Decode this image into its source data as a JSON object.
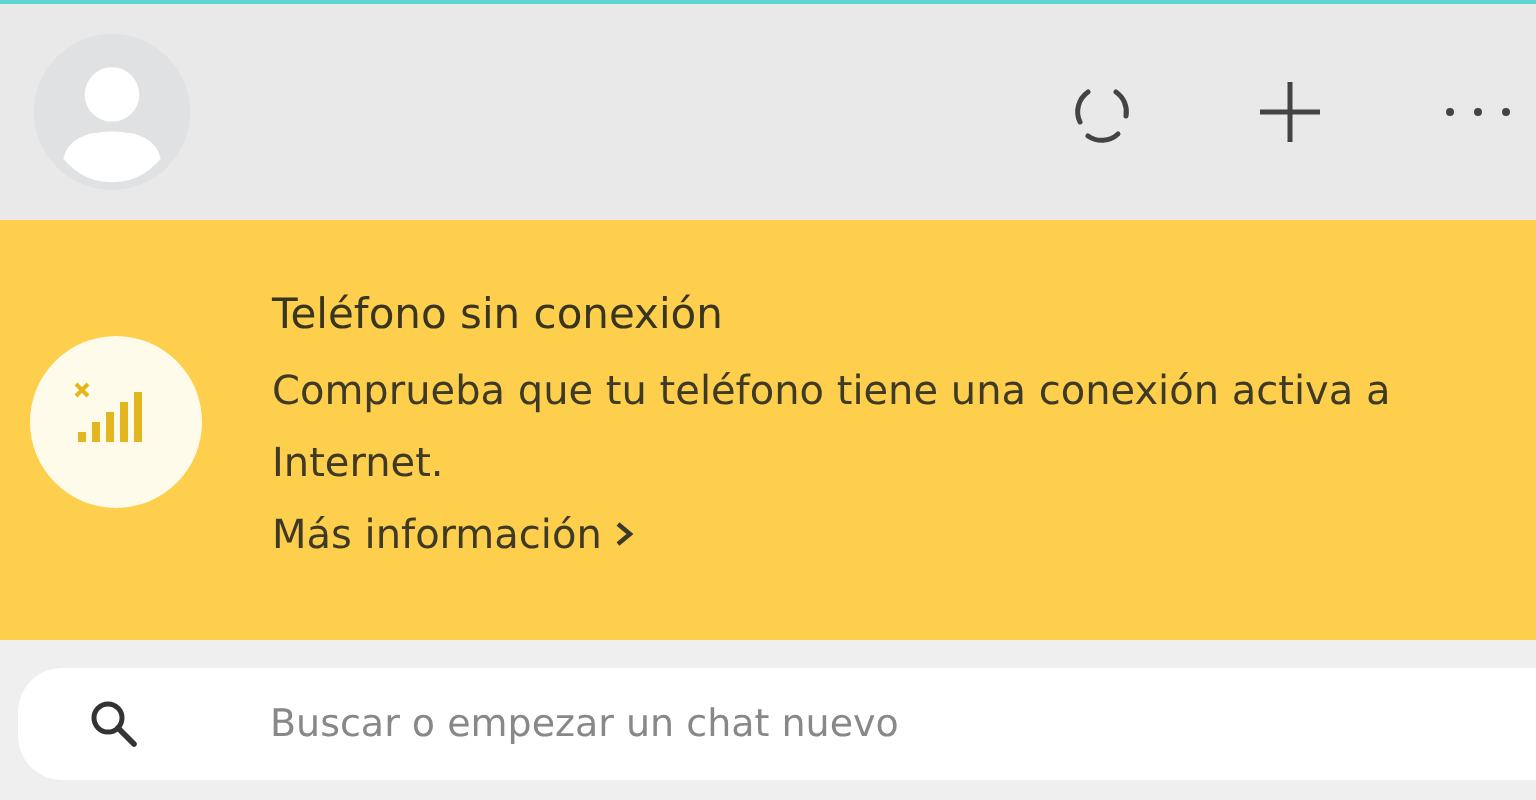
{
  "banner": {
    "title": "Teléfono sin conexión",
    "message": "Comprueba que tu teléfono tiene una conexión activa a Internet.",
    "link": "Más información"
  },
  "search": {
    "placeholder": "Buscar o empezar un chat nuevo"
  }
}
